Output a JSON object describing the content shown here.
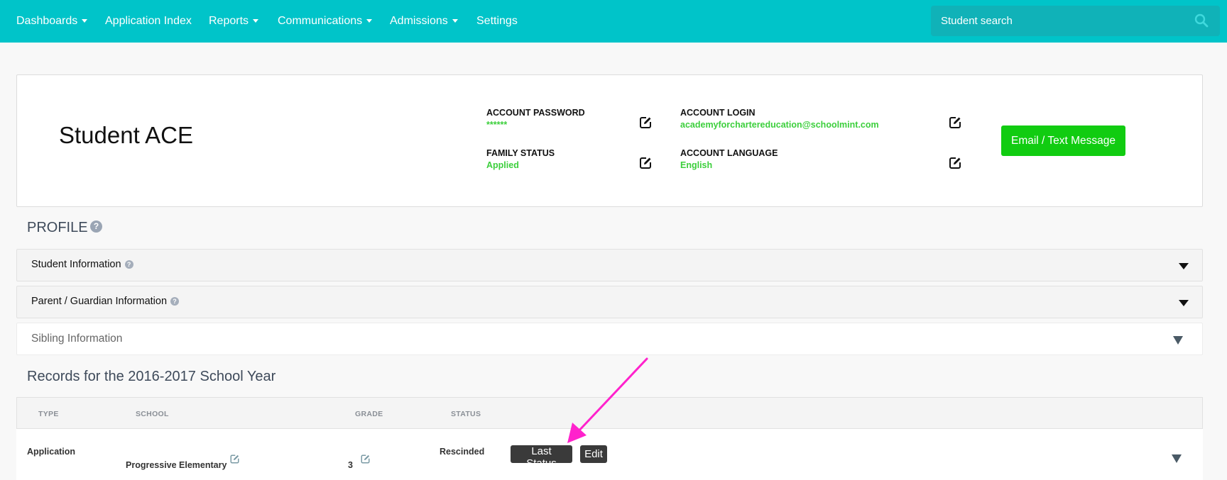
{
  "nav": {
    "items": [
      {
        "label": "Dashboards",
        "dropdown": true
      },
      {
        "label": "Application Index",
        "dropdown": false
      },
      {
        "label": "Reports",
        "dropdown": true
      },
      {
        "label": "Communications",
        "dropdown": true
      },
      {
        "label": "Admissions",
        "dropdown": true
      },
      {
        "label": "Settings",
        "dropdown": false
      }
    ],
    "search_placeholder": "Student search",
    "search_icon": "search-icon"
  },
  "student": {
    "name": "Student ACE",
    "account_password_label": "ACCOUNT PASSWORD",
    "account_password_value": "******",
    "family_status_label": "FAMILY STATUS",
    "family_status_value": "Applied",
    "account_login_label": "ACCOUNT LOGIN",
    "account_login_value": "academyforchartereducation@schoolmint.com",
    "account_language_label": "ACCOUNT LANGUAGE",
    "account_language_value": "English",
    "email_button": "Email / Text Message"
  },
  "profile": {
    "title": "PROFILE",
    "help": "?",
    "sections": [
      {
        "label": "Student Information",
        "help": "?"
      },
      {
        "label": "Parent / Guardian Information",
        "help": "?"
      },
      {
        "label": "Sibling Information"
      }
    ]
  },
  "records": {
    "title": "Records for the 2016-2017 School Year",
    "columns": [
      "TYPE",
      "SCHOOL",
      "GRADE",
      "STATUS"
    ],
    "rows": [
      {
        "type": "Application",
        "school": "Progressive Elementary",
        "grade": "3",
        "status": "Rescinded",
        "last_status_button": "Last Status",
        "edit_button": "Edit"
      }
    ]
  },
  "colors": {
    "nav_bg": "#00c4c9",
    "accent_green": "#11cc11",
    "value_green": "#3ccf3c",
    "annotation_arrow": "#ff22cc"
  }
}
